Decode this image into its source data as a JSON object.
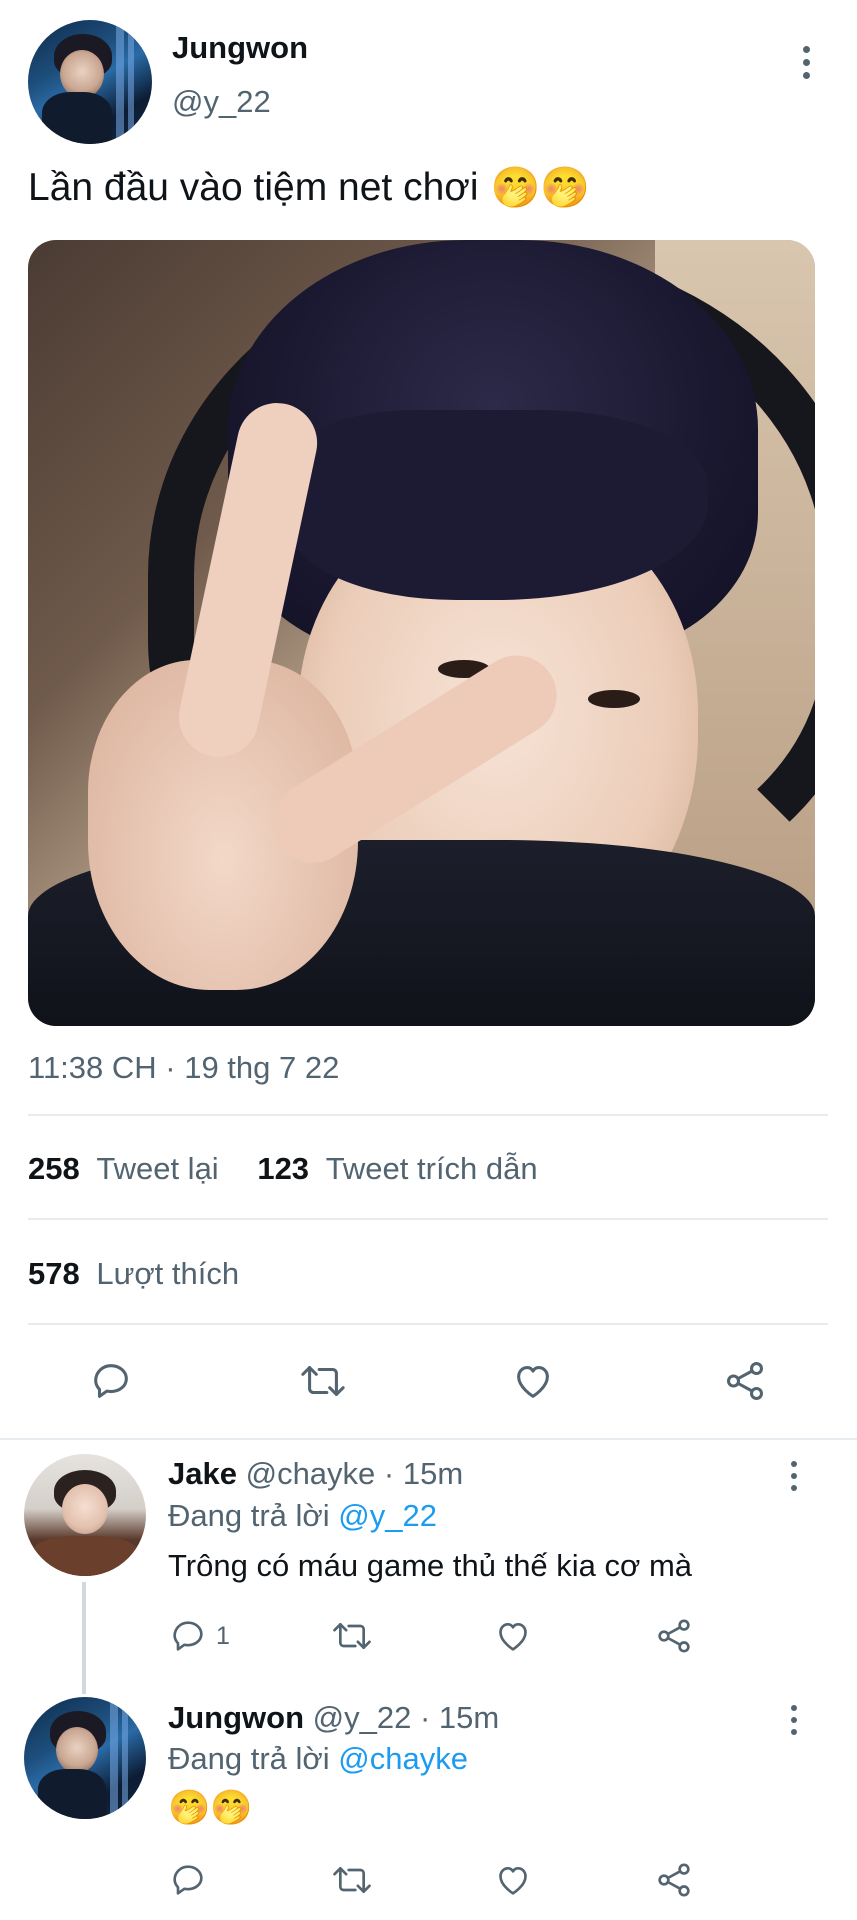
{
  "tweet": {
    "author_name": "Jungwon",
    "author_handle": "@y_22",
    "text": "Lần đầu vào tiệm net chơi",
    "emoji": "🤭🤭",
    "timestamp": "11:38 CH · 19 thg 7 22",
    "retweets_count": "258",
    "retweets_label": "Tweet lại",
    "quotes_count": "123",
    "quotes_label": "Tweet trích dẫn",
    "likes_count": "578",
    "likes_label": "Lượt thích"
  },
  "replies": [
    {
      "name": "Jake",
      "handle": "@chayke",
      "time": "· 15m",
      "replying_prefix": "Đang trả lời",
      "replying_to": "@y_22",
      "text": "Trông có máu game thủ thế kia cơ mà",
      "reply_count": "1"
    },
    {
      "name": "Jungwon",
      "handle": "@y_22",
      "time": "· 15m",
      "replying_prefix": "Đang trả lời",
      "replying_to": "@chayke",
      "text": "🤭🤭",
      "reply_count": ""
    }
  ],
  "icons": {
    "reply": "reply-icon",
    "retweet": "retweet-icon",
    "like": "heart-icon",
    "share": "share-icon",
    "more": "more-vertical-icon"
  },
  "colors": {
    "text": "#0f1419",
    "muted": "#536471",
    "link": "#1d9bf0",
    "divider": "#e6ecf0"
  }
}
